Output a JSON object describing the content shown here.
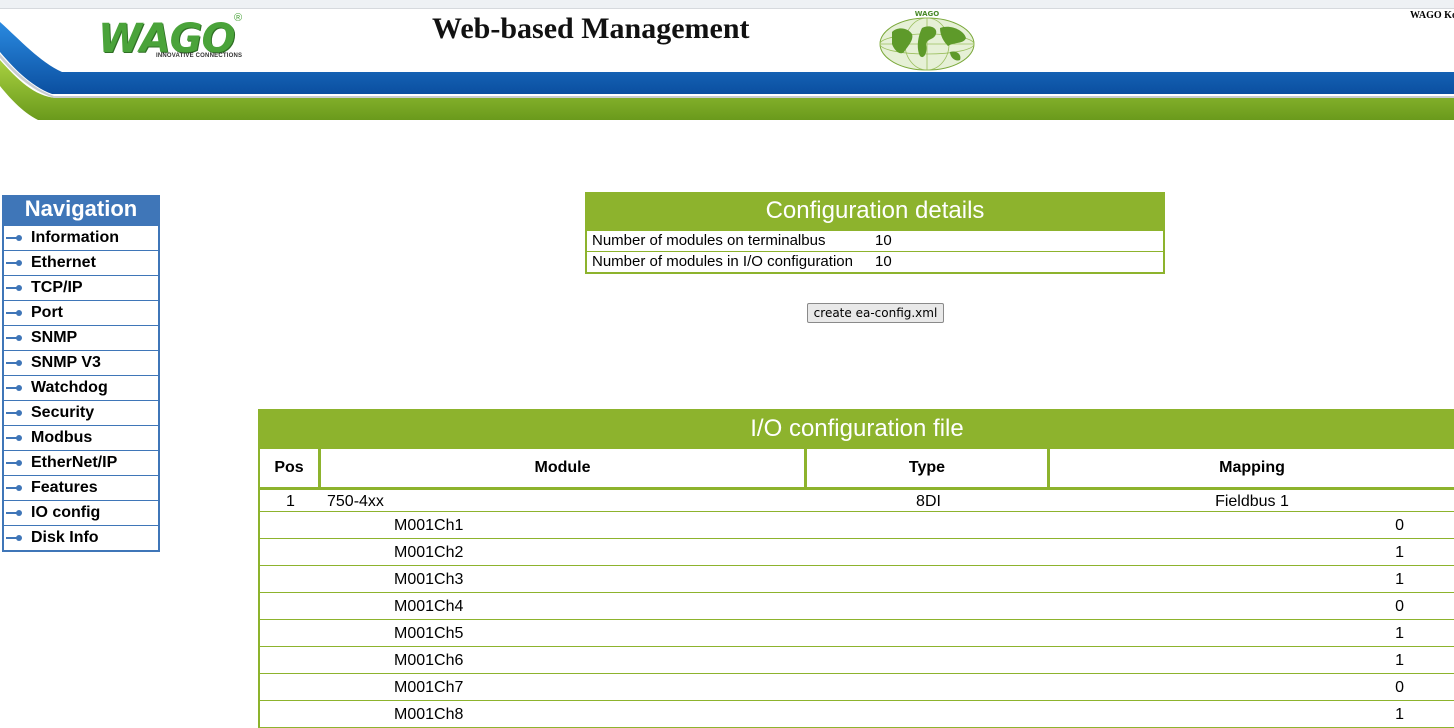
{
  "header": {
    "logo_text": "WAGO",
    "logo_tagline": "INNOVATIVE CONNECTIONS",
    "logo_registered": "®",
    "title": "Web-based Management",
    "globe_label": "WAGO",
    "corner_text": "WAGO Ko"
  },
  "navigation": {
    "title": "Navigation",
    "items": [
      {
        "label": "Information"
      },
      {
        "label": "Ethernet"
      },
      {
        "label": "TCP/IP"
      },
      {
        "label": "Port"
      },
      {
        "label": "SNMP"
      },
      {
        "label": "SNMP V3"
      },
      {
        "label": "Watchdog"
      },
      {
        "label": "Security"
      },
      {
        "label": "Modbus"
      },
      {
        "label": "EtherNet/IP"
      },
      {
        "label": "Features"
      },
      {
        "label": "IO config"
      },
      {
        "label": "Disk Info"
      }
    ]
  },
  "config_details": {
    "title": "Configuration details",
    "rows": [
      {
        "label": "Number of modules on terminalbus",
        "value": "10"
      },
      {
        "label": "Number of modules in I/O configuration",
        "value": "10"
      }
    ],
    "create_button": "create ea-config.xml"
  },
  "io_config": {
    "title": "I/O configuration file",
    "columns": {
      "pos": "Pos",
      "module": "Module",
      "type": "Type",
      "mapping": "Mapping"
    },
    "module": {
      "pos": "1",
      "module": "750-4xx",
      "type": "8DI",
      "mapping": "Fieldbus 1"
    },
    "channels": [
      {
        "name": "M001Ch1",
        "value": "0"
      },
      {
        "name": "M001Ch2",
        "value": "1"
      },
      {
        "name": "M001Ch3",
        "value": "1"
      },
      {
        "name": "M001Ch4",
        "value": "0"
      },
      {
        "name": "M001Ch5",
        "value": "1"
      },
      {
        "name": "M001Ch6",
        "value": "1"
      },
      {
        "name": "M001Ch7",
        "value": "0"
      },
      {
        "name": "M001Ch8",
        "value": "1"
      }
    ]
  },
  "colors": {
    "nav_blue": "#3f76b8",
    "wago_green": "#8db32d",
    "logo_green": "#4aa33a",
    "band_blue": "#1a6fc4"
  }
}
